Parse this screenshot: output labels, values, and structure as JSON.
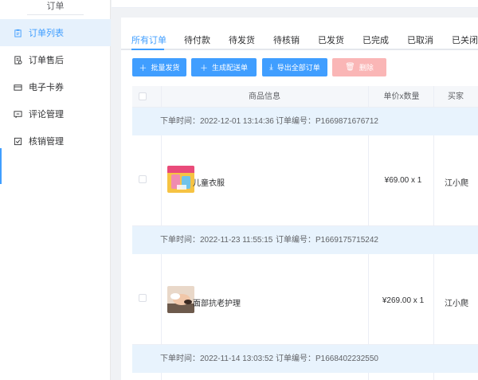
{
  "sidebar": {
    "group_title": "订单",
    "items": [
      {
        "label": "订单列表",
        "icon": "clipboard-icon",
        "active": true
      },
      {
        "label": "订单售后",
        "icon": "receipt-icon",
        "active": false
      },
      {
        "label": "电子卡券",
        "icon": "card-icon",
        "active": false
      },
      {
        "label": "评论管理",
        "icon": "comment-icon",
        "active": false
      },
      {
        "label": "核销管理",
        "icon": "checkbox-icon",
        "active": false
      }
    ]
  },
  "tabs": [
    {
      "label": "所有订单",
      "active": true
    },
    {
      "label": "待付款",
      "active": false
    },
    {
      "label": "待发货",
      "active": false
    },
    {
      "label": "待核销",
      "active": false
    },
    {
      "label": "已发货",
      "active": false
    },
    {
      "label": "已完成",
      "active": false
    },
    {
      "label": "已取消",
      "active": false
    },
    {
      "label": "已关闭",
      "active": false
    }
  ],
  "toolbar": {
    "batch_ship": "批量发货",
    "generate_delivery": "生成配送单",
    "export_all": "导出全部订单",
    "delete": "删除"
  },
  "table": {
    "headers": [
      "商品信息",
      "单价x数量",
      "买家"
    ],
    "orders": [
      {
        "time_label": "下单时间：2022-12-01 13:14:36",
        "number_label": "订单编号：P1669871676712",
        "product": "儿童衣服",
        "price_qty": "¥69.00 x 1",
        "buyer": "江小爬"
      },
      {
        "time_label": "下单时间：2022-11-23 11:55:15",
        "number_label": "订单编号：P1669175715242",
        "product": "面部抗老护理",
        "price_qty": "¥269.00 x 1",
        "buyer": "江小爬"
      },
      {
        "time_label": "下单时间：2022-11-14 13:03:52",
        "number_label": "订单编号：P1668402232550"
      }
    ]
  },
  "colors": {
    "primary": "#409eff",
    "danger_disabled": "#fab6b6",
    "order_bar_bg": "#e8f3fd",
    "active_menu_bg": "#e6f1fc"
  }
}
